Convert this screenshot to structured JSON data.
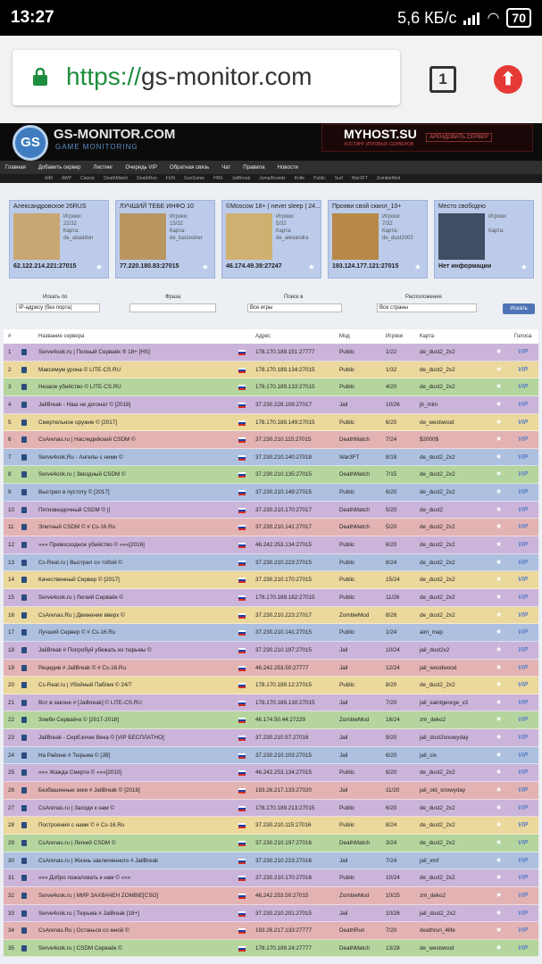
{
  "statusbar": {
    "time": "13:27",
    "speed": "5,6 КБ/с",
    "battery": "70"
  },
  "browser": {
    "url_scheme": "https://",
    "url_host": "gs-monitor.com",
    "tabs_count": "1"
  },
  "site": {
    "logo_text": "GS",
    "title": "GS-MONITOR.COM",
    "subtitle": "GAME MONITORING",
    "ad_title": "MYHOST.SU",
    "ad_sub": "ХОСТИНГ ИГРОВЫХ СЕРВЕРОВ",
    "ad_button": "АРЕНДОВАТЬ СЕРВЕР",
    "nav": [
      "Главная",
      "Добавить сервер",
      "Листинг",
      "Очередь VIP",
      "Обратная связь",
      "Чат",
      "Правила",
      "Новости"
    ],
    "subnav": [
      "AIM",
      "AWP",
      "Classic",
      "DeathMatch",
      "DeathRun",
      "FUN",
      "GunGame",
      "HNS",
      "JailBreak",
      "Jump/Kreedz",
      "Knife",
      "Public",
      "Surf",
      "War3FT",
      "ZombieMod"
    ]
  },
  "vip_cards": [
    {
      "name": "Александровское 26RUS",
      "stats": "Игроки:\n22/32\nКарта:\nde_abaddon",
      "ip": "62.122.214.221:27015",
      "map_color": "#c9a772"
    },
    {
      "name": "ЛУЧШИЙ ТЕБЕ ИНФО 10",
      "stats": "Игроки:\n15/32\nКарта:\nde_barzesher",
      "ip": "77.220.180.83:27015",
      "map_color": "#b99660"
    },
    {
      "name": "©Moscow 18+ | never sleep | 24...",
      "stats": "Игроки:\n5/32\nКарта:\nde_alexandra",
      "ip": "46.174.49.39:27247",
      "map_color": "#d0b070"
    },
    {
      "name": "Прояви свой скилл_10+",
      "stats": "Игроки:\n7/32\nКарта:\nde_dust2002",
      "ip": "193.124.177.121:27015",
      "map_color": "#b88848"
    },
    {
      "name": "Место свободно",
      "stats": "Игроки:\n\nКарта:",
      "ip": "Нет информации",
      "map_color": "#3e4f63"
    }
  ],
  "filter": {
    "search_by_label": "Искать по",
    "search_by_value": "IP-адресу (без порта)",
    "phrase_label": "Фраза",
    "phrase_value": "",
    "games_label": "Поиск в",
    "games_value": "Все игры",
    "country_label": "Расположение",
    "country_value": "Все страны",
    "button": "Искать"
  },
  "table": {
    "headers": {
      "num": "#",
      "name": "Название сервера",
      "addr": "Адрес",
      "mod": "Мод",
      "players": "Игроки",
      "map": "Карта",
      "votes": "Голоса"
    },
    "rows": [
      {
        "n": "1",
        "name": "Serve4ook.ru | Полный Серваёк ® 18+ [HS]",
        "ip": "178.170.189.151:27777",
        "mod": "Public",
        "pl": "1/22",
        "map": "de_dust2_2x2",
        "bg": "#cbb4d9"
      },
      {
        "n": "2",
        "name": "Максимум урона © LITE-CS.RU",
        "ip": "178.170.189.134:27015",
        "mod": "Public",
        "pl": "1/32",
        "map": "de_dust2_2x2",
        "bg": "#ebd89c"
      },
      {
        "n": "3",
        "name": "Незаое убийство © LITE-CS.RU",
        "ip": "178.170.189.133:27015",
        "mod": "Public",
        "pl": "4/20",
        "map": "de_dust2_2x2",
        "bg": "#b5d59f"
      },
      {
        "n": "4",
        "name": "JailBreak - Наш не догонат © [2018]",
        "ip": "37.230.228.109:27017",
        "mod": "Jail",
        "pl": "10/26",
        "map": "jb_mini",
        "bg": "#cbb4d9"
      },
      {
        "n": "5",
        "name": "Смертельное оружие © [2017]",
        "ip": "178.170.189.149:27015",
        "mod": "Public",
        "pl": "6/20",
        "map": "de_westwood",
        "bg": "#ebd89c"
      },
      {
        "n": "6",
        "name": "CsArenas.ru | Наследийский CSDM ©",
        "ip": "37.230.210.115:27015",
        "mod": "DeathMatch",
        "pl": "7/24",
        "map": "$2000$",
        "bg": "#e3b3b3"
      },
      {
        "n": "7",
        "name": "Serve4ook.Ru - Ангелы с ними ©",
        "ip": "37.230.210.140:27018",
        "mod": "War3FT",
        "pl": "8/18",
        "map": "de_dust2_2x2",
        "bg": "#aec0e0"
      },
      {
        "n": "8",
        "name": "Serve4ook.ru | Звездный CSDM ©",
        "ip": "37.230.210.135:27015",
        "mod": "DeathMatch",
        "pl": "7/15",
        "map": "de_dust2_2x2",
        "bg": "#b5d59f"
      },
      {
        "n": "9",
        "name": "Выстрел в пустоту © [2017]",
        "ip": "37.230.210.149:27015",
        "mod": "Public",
        "pl": "6/20",
        "map": "de_dust2_2x2",
        "bg": "#aec0e0"
      },
      {
        "n": "10",
        "name": "Пятизвездочный CSDM © ||",
        "ip": "37.230.210.170:27017",
        "mod": "DeathMatch",
        "pl": "5/20",
        "map": "de_dust2",
        "bg": "#cbb4d9"
      },
      {
        "n": "11",
        "name": "Элитный CSDM © # Cs-16.Ru",
        "ip": "37.230.210.141:27017",
        "mod": "DeathMatch",
        "pl": "5/20",
        "map": "de_dust2_2x2",
        "bg": "#e3b3b3"
      },
      {
        "n": "12",
        "name": "»»» Превосходное убийство © «««[2016]",
        "ip": "46.242.253.134:27015",
        "mod": "Public",
        "pl": "6/20",
        "map": "de_dust2_2x2",
        "bg": "#cbb4d9"
      },
      {
        "n": "13",
        "name": "Cs-Real.ru | Выстрел со тобой ©",
        "ip": "37.230.210.223:27015",
        "mod": "Public",
        "pl": "8/24",
        "map": "de_dust2_2x2",
        "bg": "#aec0e0"
      },
      {
        "n": "14",
        "name": "Качественный Сервер © [2017]",
        "ip": "37.230.210.170:27015",
        "mod": "Public",
        "pl": "15/24",
        "map": "de_dust2_2x2",
        "bg": "#ebd89c"
      },
      {
        "n": "15",
        "name": "Serve4ook.ru | Легкий Серваёк ©",
        "ip": "178.170.189.182:27015",
        "mod": "Public",
        "pl": "11/26",
        "map": "de_dust2_2x2",
        "bg": "#cbb4d9"
      },
      {
        "n": "16",
        "name": "CsArenas.Ru | Движение вверх ©",
        "ip": "37.230.210.223:27017",
        "mod": "ZombieMod",
        "pl": "8/26",
        "map": "de_dust2_2x2",
        "bg": "#ebd89c"
      },
      {
        "n": "17",
        "name": "Лучший Сервер © # Cs-16.Ru",
        "ip": "37.230.210.141:27015",
        "mod": "Public",
        "pl": "1/24",
        "map": "aim_map",
        "bg": "#aec0e0"
      },
      {
        "n": "18",
        "name": "JailBreak # Попробуй убежать из тюрьмы ©",
        "ip": "37.230.210.197:27015",
        "mod": "Jail",
        "pl": "10/24",
        "map": "jail_dust2x2",
        "bg": "#cbb4d9"
      },
      {
        "n": "19",
        "name": "Рецидив # JailBreak © # Cs-16.Ru",
        "ip": "46.242.253.50:27777",
        "mod": "Jail",
        "pl": "12/24",
        "map": "jail_woodwood",
        "bg": "#e3b3b3"
      },
      {
        "n": "20",
        "name": "Cs-Real.ru | Убойный Паблик © 24/7",
        "ip": "178.170.189.12:27015",
        "mod": "Public",
        "pl": "8/20",
        "map": "de_dust2_2x2",
        "bg": "#ebd89c"
      },
      {
        "n": "21",
        "name": "Вот в законе # [Jailbreak] © LITE-CS.RU",
        "ip": "178.170.189.130:27015",
        "mod": "Jail",
        "pl": "7/20",
        "map": "jail_saintgeorge_v2",
        "bg": "#cbb4d9"
      },
      {
        "n": "22",
        "name": "Зомби Серваёчк © [2017-2018]",
        "ip": "46.174.50.44:27229",
        "mod": "ZombieMod",
        "pl": "16/24",
        "map": "zm_deko2",
        "bg": "#b5d59f"
      },
      {
        "n": "23",
        "name": "JailBreak - СерЕзочек Века © [VIP БЕСПЛАТНО]",
        "ip": "37.230.210.57:27016",
        "mod": "Jail",
        "pl": "9/20",
        "map": "jail_dust2snowyday",
        "bg": "#cbb4d9"
      },
      {
        "n": "24",
        "name": "На Районе # Тюрьма © [JB]",
        "ip": "37.230.210.103:27015",
        "mod": "Jail",
        "pl": "6/20",
        "map": "jail_cix",
        "bg": "#aec0e0"
      },
      {
        "n": "25",
        "name": "»»» Жажда Смерти © «««[2010]",
        "ip": "46.242.253.134:27015",
        "mod": "Public",
        "pl": "6/20",
        "map": "de_dust2_2x2",
        "bg": "#cbb4d9"
      },
      {
        "n": "26",
        "name": "Безбашенные зеки # JailBreak © [2018]",
        "ip": "193.26.217.133:27020",
        "mod": "Jail",
        "pl": "11/20",
        "map": "jail_old_snowyday",
        "bg": "#e3b3b3"
      },
      {
        "n": "27",
        "name": "CsArenas.ru | Заходи к нам ©",
        "ip": "178.170.189.213:27015",
        "mod": "Public",
        "pl": "6/20",
        "map": "de_dust2_2x2",
        "bg": "#cbb4d9"
      },
      {
        "n": "28",
        "name": "Построения с нами © # Cs-16.Ru",
        "ip": "37.230.210.115:27016",
        "mod": "Public",
        "pl": "8/24",
        "map": "de_dust2_2x2",
        "bg": "#ebd89c"
      },
      {
        "n": "29",
        "name": "CsArenas.ru | Легкий CSDM ©",
        "ip": "37.230.210.197:27016",
        "mod": "DeathMatch",
        "pl": "3/24",
        "map": "de_dust2_2x2",
        "bg": "#b5d59f"
      },
      {
        "n": "30",
        "name": "CsArenas.ru | Жизнь заключенного # JailBreak",
        "ip": "37.230.210.223:27016",
        "mod": "Jail",
        "pl": "7/24",
        "map": "jail_xmf",
        "bg": "#aec0e0"
      },
      {
        "n": "31",
        "name": "»»» Добро пожаловать к нам © «««",
        "ip": "37.230.210.170:27016",
        "mod": "Public",
        "pl": "10/24",
        "map": "de_dust2_2x2",
        "bg": "#cbb4d9"
      },
      {
        "n": "32",
        "name": "Serve4ook.ru | МИР ЗАХВАЧЕН ZOMBIE[CSO]",
        "ip": "46.242.253.50:27015",
        "mod": "ZombieMod",
        "pl": "10/25",
        "map": "zm_deko2",
        "bg": "#e3b3b3"
      },
      {
        "n": "33",
        "name": "Serve4ook.ru | Тюрьма # JaiBreak [18+]",
        "ip": "37.230.210.201:27015",
        "mod": "Jail",
        "pl": "10/26",
        "map": "jail_dust2_2x2",
        "bg": "#cbb4d9"
      },
      {
        "n": "34",
        "name": "CsArenas.Ru | Останься со мной ©",
        "ip": "193.26.217.133:27777",
        "mod": "DeathRun",
        "pl": "7/20",
        "map": "deathrun_4life",
        "bg": "#e3b3b3"
      },
      {
        "n": "35",
        "name": "Serve4ook.ru | CSDM Серваёк ©",
        "ip": "178.170.189.24:27777",
        "mod": "DeathMatch",
        "pl": "13/28",
        "map": "de_westwood",
        "bg": "#b5d59f"
      }
    ]
  }
}
